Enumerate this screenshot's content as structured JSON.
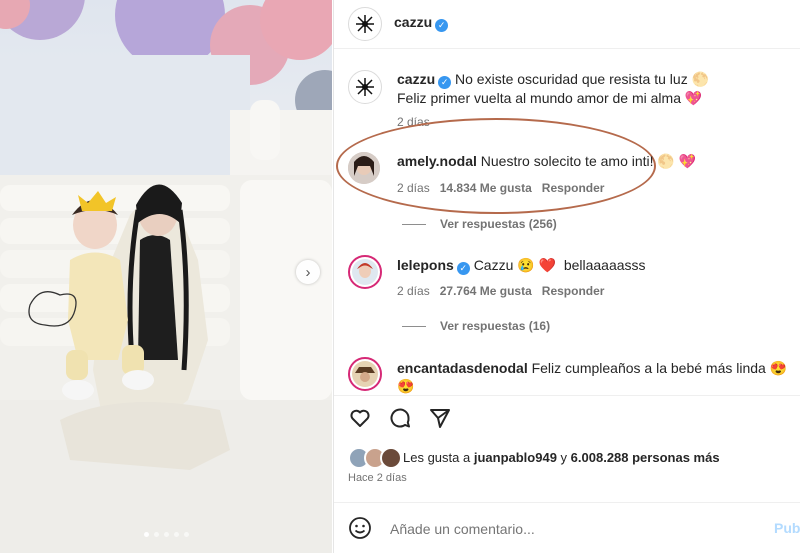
{
  "post": {
    "carousel": {
      "count": 5,
      "active_index": 0
    }
  },
  "header": {
    "username": "cazzu",
    "verified": true
  },
  "caption": {
    "username": "cazzu",
    "line1": "No existe oscuridad que resista tu luz",
    "line1_emoji": "🌕",
    "line2": "Feliz primer vuelta al mundo amor de mi alma",
    "line2_emoji": "💖",
    "age": "2 días"
  },
  "comments": [
    {
      "username": "amely.nodal",
      "verified": false,
      "text": "Nuestro solecito te amo inti!",
      "emoji": "🌕 💖",
      "age": "2 días",
      "likes": "14.834 Me gusta",
      "reply": "Responder",
      "view_replies": "Ver respuestas (256)"
    },
    {
      "username": "lelepons",
      "verified": true,
      "text": "Cazzu",
      "emoji": "😢 ❤️",
      "text2": "bellaaaaasss",
      "age": "2 días",
      "likes": "27.764 Me gusta",
      "reply": "Responder",
      "view_replies": "Ver respuestas (16)"
    },
    {
      "username": "encantadasdenodal",
      "verified": false,
      "text": "Feliz cumpleaños a la bebé más linda",
      "emoji": "😍",
      "emoji2": "😍"
    }
  ],
  "likes_summary": {
    "prefix": "Les gusta a",
    "user": "juanpablo949",
    "joiner": "y",
    "others": "6.008.288 personas más"
  },
  "post_age": "Hace 2 días",
  "comment_input": {
    "placeholder": "Añade un comentario...",
    "publish": "Publicar"
  },
  "colors": {
    "verified": "#3797f0",
    "highlight_ring": "#b56a4c",
    "story_ring": "#d62976"
  }
}
